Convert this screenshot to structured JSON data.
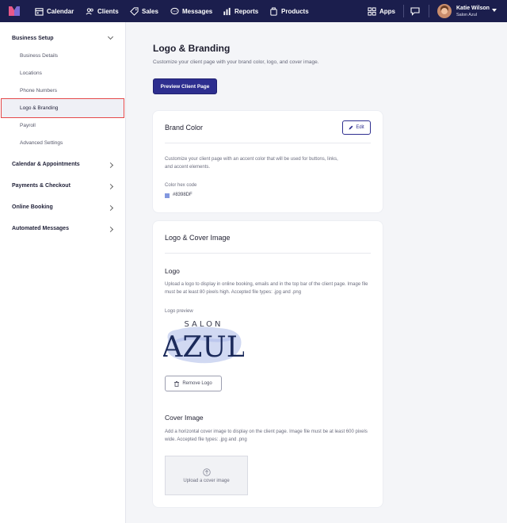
{
  "nav": {
    "items": [
      {
        "label": "Calendar",
        "icon": "calendar-icon"
      },
      {
        "label": "Clients",
        "icon": "clients-icon"
      },
      {
        "label": "Sales",
        "icon": "tag-icon"
      },
      {
        "label": "Messages",
        "icon": "messages-icon"
      },
      {
        "label": "Reports",
        "icon": "bar-chart-icon"
      },
      {
        "label": "Products",
        "icon": "product-icon"
      }
    ],
    "apps_label": "Apps",
    "user_name": "Katie Wilson",
    "user_salon": "Salon Azul"
  },
  "sidebar": {
    "sections": [
      {
        "label": "Business Setup",
        "expanded": true
      },
      {
        "label": "Calendar & Appointments"
      },
      {
        "label": "Payments & Checkout"
      },
      {
        "label": "Online Booking"
      },
      {
        "label": "Automated Messages"
      }
    ],
    "sub_items": [
      "Business Details",
      "Locations",
      "Phone Numbers",
      "Logo & Branding",
      "Payroll",
      "Advanced Settings"
    ],
    "active": "Logo & Branding"
  },
  "main": {
    "title": "Logo & Branding",
    "subtitle": "Customize your client page with your brand color, logo, and cover image.",
    "preview_button": "Preview Client Page",
    "brand_color": {
      "heading": "Brand Color",
      "edit_label": "Edit",
      "description": "Customize your client page with an accent color that will be used for buttons, links, and accent elements.",
      "hex_label": "Color hex code",
      "hex_value": "#8398DF",
      "swatch_color": "#8398DF"
    },
    "cover": {
      "heading": "Logo & Cover Image",
      "logo_heading": "Logo",
      "logo_description": "Upload a logo to display in online booking, emails and in the top bar of the client page. Image file must be at least 80 pixels high. Accepted file types: .jpg and .png",
      "logo_preview_label": "Logo preview",
      "logo_text_top": "SALON",
      "logo_text_main": "AZUL",
      "remove_logo": "Remove Logo",
      "cover_heading": "Cover Image",
      "cover_description": "Add a horizontal cover image to display on the client page. Image file must be at least 600 pixels wide. Accepted file types: .jpg and .png",
      "upload_label": "Upload a cover image"
    }
  },
  "colors": {
    "nav_bg": "#1b1e4d",
    "primary": "#2d2e8f",
    "active_outline": "#e5494a"
  }
}
